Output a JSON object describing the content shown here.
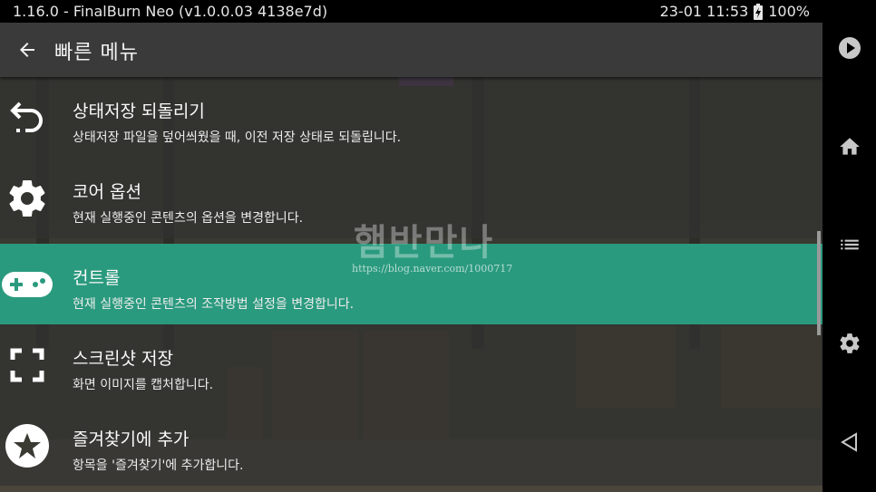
{
  "status_bar": {
    "app_info": "1.16.0 - FinalBurn Neo (v1.0.0.03  4138e7d)",
    "datetime": "23-01 11:53",
    "battery": "100%"
  },
  "header": {
    "title": "빠른 메뉴",
    "back_icon": "arrow-left-icon"
  },
  "menu": {
    "items": [
      {
        "title": "상태저장 되돌리기",
        "subtitle": "상태저장 파일을 덮어씌웠을 때, 이전 저장 상태로 되돌립니다.",
        "icon": "undo-icon"
      },
      {
        "title": "코어 옵션",
        "subtitle": "현재 실행중인 콘텐츠의 옵션을 변경합니다.",
        "icon": "gear-icon"
      },
      {
        "title": "컨트롤",
        "subtitle": "현재 실행중인 콘텐츠의 조작방법 설정을 변경합니다.",
        "icon": "gamepad-icon",
        "selected": true
      },
      {
        "title": "스크린샷 저장",
        "subtitle": "화면 이미지를 캡처합니다.",
        "icon": "screenshot-icon"
      },
      {
        "title": "즐겨찾기에 추가",
        "subtitle": "항목을 '즐겨찾기'에 추가합니다.",
        "icon": "star-icon"
      }
    ]
  },
  "watermark": {
    "text": "햄반만나",
    "url": "https://blog.naver.com/1000717"
  },
  "nav_bar": [
    "play-icon",
    "home-icon",
    "list-icon",
    "gear-icon",
    "back-triangle-icon"
  ],
  "colors": {
    "selected": "#2a9a7e",
    "app_bar": "#3a3a3a",
    "background": "#3d3d37"
  }
}
